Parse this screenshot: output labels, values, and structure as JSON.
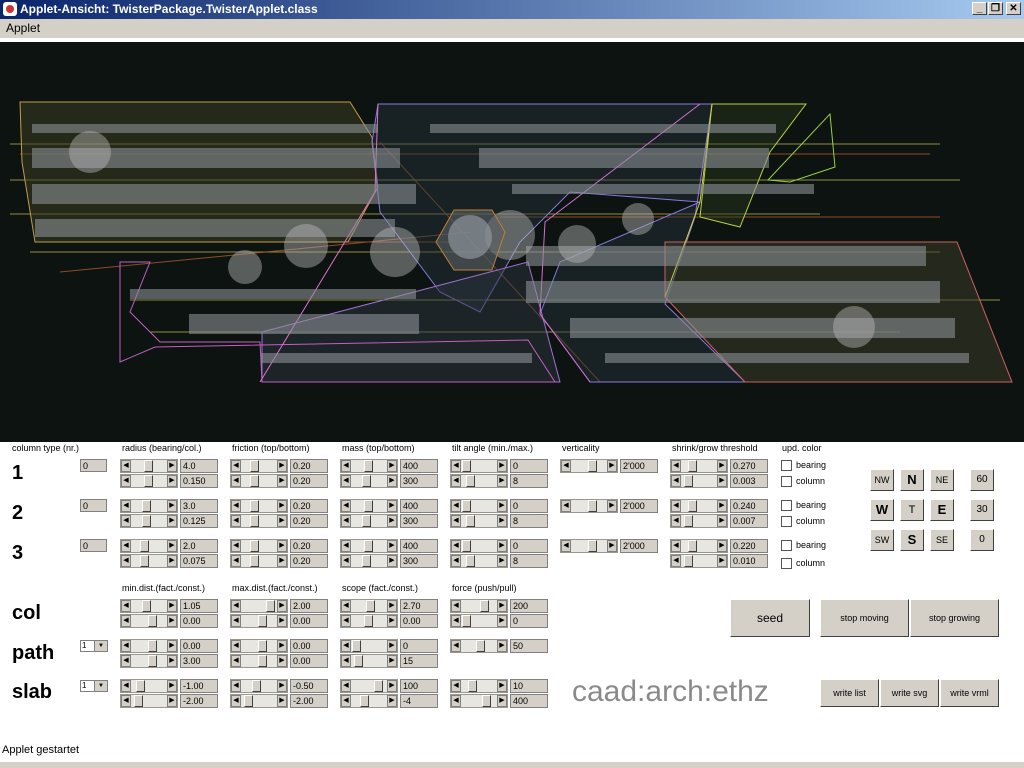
{
  "window": {
    "title": "Applet-Ansicht: TwisterPackage.TwisterApplet.class"
  },
  "menu": {
    "applet": "Applet"
  },
  "headers": {
    "column_type": "column type (nr.)",
    "radius": "radius (bearing/col.)",
    "friction": "friction (top/bottom)",
    "mass": "mass (top/bottom)",
    "tilt": "tilt angle (min./max.)",
    "verticality": "verticality",
    "shrink": "shrink/grow threshold",
    "upd_color": "upd. color",
    "min_dist": "min.dist.(fact./const.)",
    "max_dist": "max.dist.(fact./const.)",
    "scope": "scope (fact./const.)",
    "force": "force (push/pull)"
  },
  "rows": [
    {
      "label": "1",
      "nr": "0",
      "radius": [
        "4.0",
        "0.150"
      ],
      "friction": [
        "0.20",
        "0.20"
      ],
      "mass": [
        "400",
        "300"
      ],
      "tilt": [
        "0",
        "8"
      ],
      "verticality": "2'000",
      "shrink": [
        "0.270",
        "0.003"
      ],
      "bearing": "bearing",
      "column": "column"
    },
    {
      "label": "2",
      "nr": "0",
      "radius": [
        "3.0",
        "0.125"
      ],
      "friction": [
        "0.20",
        "0.20"
      ],
      "mass": [
        "400",
        "300"
      ],
      "tilt": [
        "0",
        "8"
      ],
      "verticality": "2'000",
      "shrink": [
        "0.240",
        "0.007"
      ],
      "bearing": "bearing",
      "column": "column"
    },
    {
      "label": "3",
      "nr": "0",
      "radius": [
        "2.0",
        "0.075"
      ],
      "friction": [
        "0.20",
        "0.20"
      ],
      "mass": [
        "400",
        "300"
      ],
      "tilt": [
        "0",
        "8"
      ],
      "verticality": "2'000",
      "shrink": [
        "0.220",
        "0.010"
      ],
      "bearing": "bearing",
      "column": "column"
    }
  ],
  "rows2": [
    {
      "label": "col",
      "min_dist": [
        "1.05",
        "0.00"
      ],
      "max_dist": [
        "2.00",
        "0.00"
      ],
      "scope": [
        "2.70",
        "0.00"
      ],
      "force": [
        "200",
        "0"
      ]
    },
    {
      "label": "path",
      "dropdown": "1",
      "min_dist": [
        "0.00",
        "3.00"
      ],
      "max_dist": [
        "0.00",
        "0.00"
      ],
      "scope": [
        "0",
        "15"
      ],
      "force": [
        "50"
      ]
    },
    {
      "label": "slab",
      "dropdown": "1",
      "min_dist": [
        "-1.00",
        "-2.00"
      ],
      "max_dist": [
        "-0.50",
        "-2.00"
      ],
      "scope": [
        "100",
        "-4"
      ],
      "force": [
        "10",
        "400"
      ]
    }
  ],
  "compass": [
    "NW",
    "N",
    "NE",
    "W",
    "T",
    "E",
    "SW",
    "S",
    "SE"
  ],
  "speeds": [
    "60",
    "30",
    "0"
  ],
  "actions": {
    "seed": "seed",
    "stop_moving": "stop moving",
    "stop_growing": "stop growing",
    "write_list": "write list",
    "write_svg": "write svg",
    "write_vrml": "write vrml"
  },
  "logo": "caad:arch:ethz",
  "status": "Applet gestartet",
  "colors": {
    "titlebar": "#0a246a",
    "canvas_bg": "#0c1310",
    "panel_bg": "#d4d0c8"
  }
}
